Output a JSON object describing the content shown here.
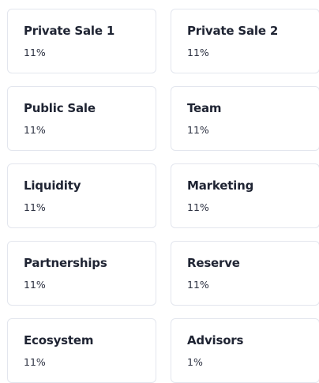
{
  "allocations": [
    {
      "label": "Private Sale 1",
      "value": "11%"
    },
    {
      "label": "Private Sale 2",
      "value": "11%"
    },
    {
      "label": "Public Sale",
      "value": "11%"
    },
    {
      "label": "Team",
      "value": "11%"
    },
    {
      "label": "Liquidity",
      "value": "11%"
    },
    {
      "label": "Marketing",
      "value": "11%"
    },
    {
      "label": "Partnerships",
      "value": "11%"
    },
    {
      "label": "Reserve",
      "value": "11%"
    },
    {
      "label": "Ecosystem",
      "value": "11%"
    },
    {
      "label": "Advisors",
      "value": "1%"
    }
  ],
  "colors": {
    "border": "#e3e6ee",
    "title": "#1f2433",
    "value": "#2b3040"
  }
}
